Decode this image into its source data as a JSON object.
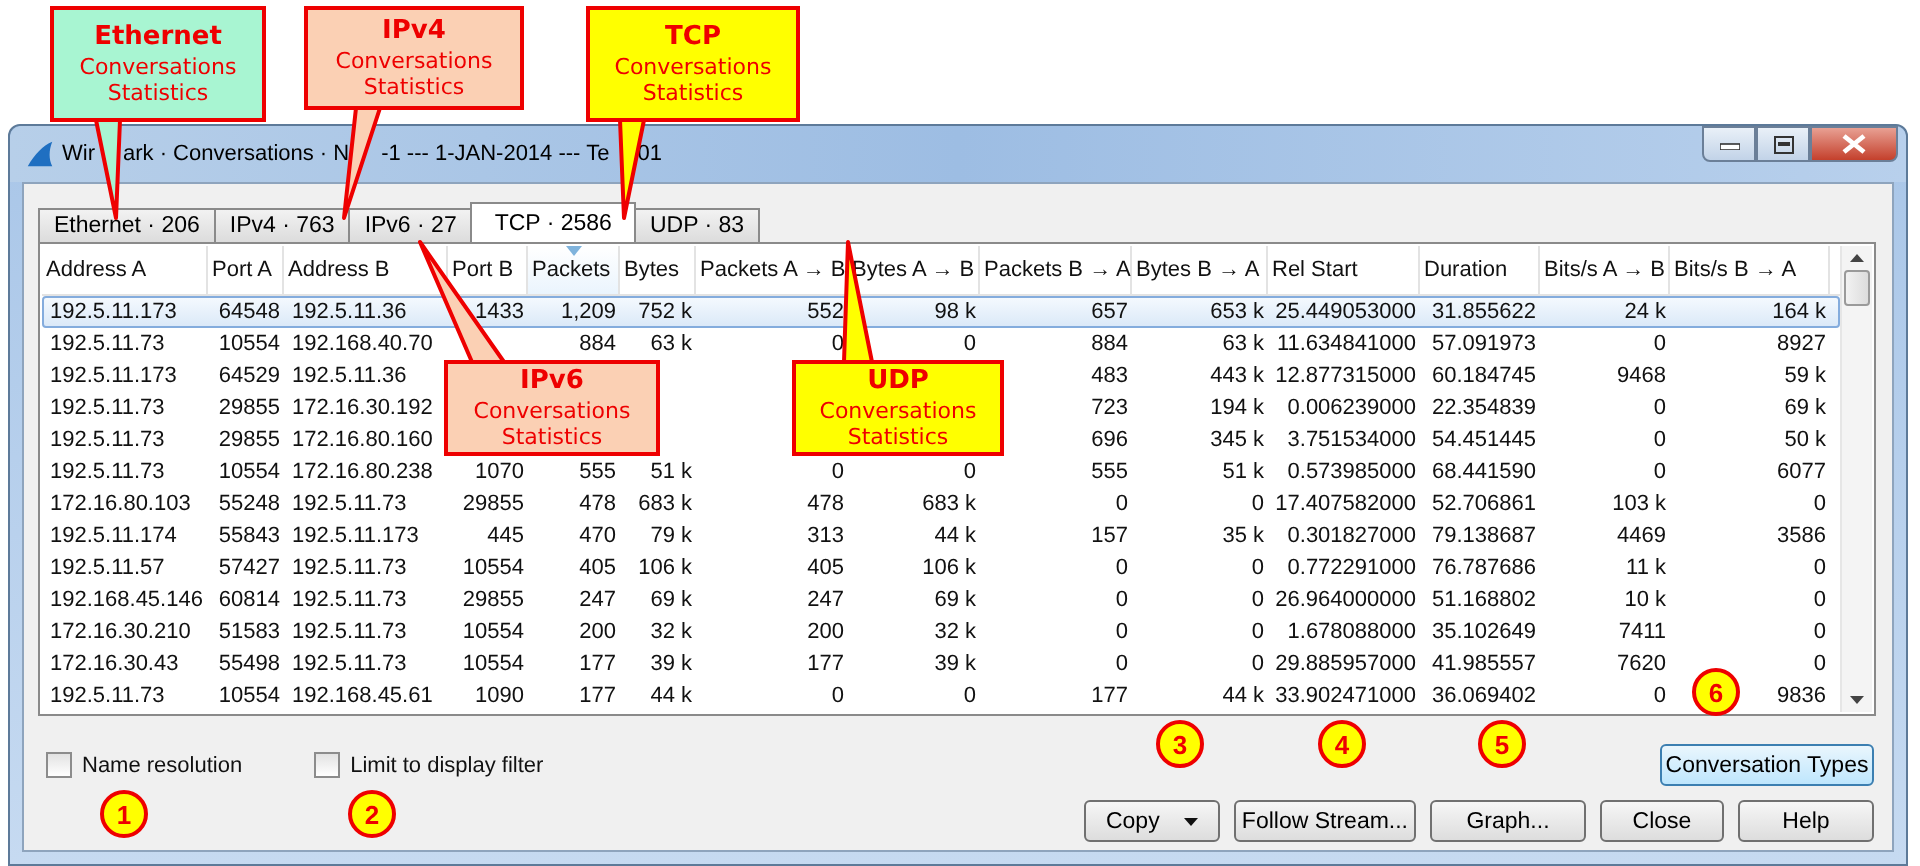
{
  "window": {
    "title_fragments": [
      "Wir",
      "ark · Conversations · N",
      "-1 --- 1-JAN-2014 --- Te",
      "01"
    ]
  },
  "tabs": [
    {
      "label": "Ethernet · 206",
      "selected": false
    },
    {
      "label": "IPv4 · 763",
      "selected": false
    },
    {
      "label": "IPv6 · 27",
      "selected": false
    },
    {
      "label": "TCP · 2586",
      "selected": true
    },
    {
      "label": "UDP · 83",
      "selected": false
    }
  ],
  "table": {
    "columns": [
      {
        "label": "Address A",
        "kind": "text",
        "sorted": false
      },
      {
        "label": "Port A",
        "kind": "number",
        "sorted": false
      },
      {
        "label": "Address B",
        "kind": "text",
        "sorted": false
      },
      {
        "label": "Port B",
        "kind": "number",
        "sorted": false
      },
      {
        "label": "Packets",
        "kind": "number",
        "sorted": true
      },
      {
        "label": "Bytes",
        "kind": "number",
        "sorted": false
      },
      {
        "label": "Packets A → B",
        "kind": "number",
        "sorted": false
      },
      {
        "label": "Bytes A → B",
        "kind": "number",
        "sorted": false
      },
      {
        "label": "Packets B → A",
        "kind": "number",
        "sorted": false
      },
      {
        "label": "Bytes B → A",
        "kind": "number",
        "sorted": false
      },
      {
        "label": "Rel Start",
        "kind": "number",
        "sorted": false
      },
      {
        "label": "Duration",
        "kind": "number",
        "sorted": false
      },
      {
        "label": "Bits/s A → B",
        "kind": "number",
        "sorted": false
      },
      {
        "label": "Bits/s B → A",
        "kind": "number",
        "sorted": false
      }
    ],
    "rows": [
      {
        "selected": true,
        "cells": [
          "192.5.11.173",
          "64548",
          "192.5.11.36",
          "1433",
          "1,209",
          "752 k",
          "552",
          "98 k",
          "657",
          "653 k",
          "25.449053000",
          "31.855622",
          "24 k",
          "164 k"
        ]
      },
      {
        "selected": false,
        "cells": [
          "192.5.11.73",
          "10554",
          "192.168.40.70",
          null,
          "884",
          "63 k",
          "0",
          "0",
          "884",
          "63 k",
          "11.634841000",
          "57.091973",
          "0",
          "8927"
        ]
      },
      {
        "selected": false,
        "cells": [
          "192.5.11.173",
          "64529",
          "192.5.11.36",
          null,
          null,
          null,
          null,
          null,
          "483",
          "443 k",
          "12.877315000",
          "60.184745",
          "9468",
          "59 k"
        ]
      },
      {
        "selected": false,
        "cells": [
          "192.5.11.73",
          "29855",
          "172.16.30.192",
          null,
          null,
          null,
          null,
          null,
          "723",
          "194 k",
          "0.006239000",
          "22.354839",
          "0",
          "69 k"
        ]
      },
      {
        "selected": false,
        "cells": [
          "192.5.11.73",
          "29855",
          "172.16.80.160",
          null,
          null,
          null,
          null,
          null,
          "696",
          "345 k",
          "3.751534000",
          "54.451445",
          "0",
          "50 k"
        ]
      },
      {
        "selected": false,
        "cells": [
          "192.5.11.73",
          "10554",
          "172.16.80.238",
          "1070",
          "555",
          "51 k",
          "0",
          "0",
          "555",
          "51 k",
          "0.573985000",
          "68.441590",
          "0",
          "6077"
        ]
      },
      {
        "selected": false,
        "cells": [
          "172.16.80.103",
          "55248",
          "192.5.11.73",
          "29855",
          "478",
          "683 k",
          "478",
          "683 k",
          "0",
          "0",
          "17.407582000",
          "52.706861",
          "103 k",
          "0"
        ]
      },
      {
        "selected": false,
        "cells": [
          "192.5.11.174",
          "55843",
          "192.5.11.173",
          "445",
          "470",
          "79 k",
          "313",
          "44 k",
          "157",
          "35 k",
          "0.301827000",
          "79.138687",
          "4469",
          "3586"
        ]
      },
      {
        "selected": false,
        "cells": [
          "192.5.11.57",
          "57427",
          "192.5.11.73",
          "10554",
          "405",
          "106 k",
          "405",
          "106 k",
          "0",
          "0",
          "0.772291000",
          "76.787686",
          "11 k",
          "0"
        ]
      },
      {
        "selected": false,
        "cells": [
          "192.168.45.146",
          "60814",
          "192.5.11.73",
          "29855",
          "247",
          "69 k",
          "247",
          "69 k",
          "0",
          "0",
          "26.964000000",
          "51.168802",
          "10 k",
          "0"
        ]
      },
      {
        "selected": false,
        "cells": [
          "172.16.30.210",
          "51583",
          "192.5.11.73",
          "10554",
          "200",
          "32 k",
          "200",
          "32 k",
          "0",
          "0",
          "1.678088000",
          "35.102649",
          "7411",
          "0"
        ]
      },
      {
        "selected": false,
        "cells": [
          "172.16.30.43",
          "55498",
          "192.5.11.73",
          "10554",
          "177",
          "39 k",
          "177",
          "39 k",
          "0",
          "0",
          "29.885957000",
          "41.985557",
          "7620",
          "0"
        ]
      },
      {
        "selected": false,
        "cells": [
          "192.5.11.73",
          "10554",
          "192.168.45.61",
          "1090",
          "177",
          "44 k",
          "0",
          "0",
          "177",
          "44 k",
          "33.902471000",
          "36.069402",
          "0",
          "9836"
        ]
      }
    ]
  },
  "checkboxes": [
    {
      "label": "Name resolution",
      "checked": false
    },
    {
      "label": "Limit to display filter",
      "checked": false
    }
  ],
  "types_button": {
    "label": "Conversation Types"
  },
  "buttons": [
    {
      "label": "Copy",
      "kind": "dropdown"
    },
    {
      "label": "Follow Stream...",
      "kind": "plain"
    },
    {
      "label": "Graph...",
      "kind": "plain"
    },
    {
      "label": "Close",
      "kind": "plain"
    },
    {
      "label": "Help",
      "kind": "plain"
    }
  ],
  "callouts": [
    {
      "title": "Ethernet",
      "text": "Conversations Statistics",
      "color": "#a8f5d2"
    },
    {
      "title": "IPv4",
      "text": "Conversations Statistics",
      "color": "#fbd0b4"
    },
    {
      "title": "TCP",
      "text": "Conversations Statistics",
      "color": "#ffff00"
    },
    {
      "title": "IPv6",
      "text": "Conversations Statistics",
      "color": "#fbd0b4"
    },
    {
      "title": "UDP",
      "text": "Conversations Statistics",
      "color": "#ffff00"
    }
  ],
  "markers": [
    "1",
    "2",
    "3",
    "4",
    "5",
    "6"
  ]
}
